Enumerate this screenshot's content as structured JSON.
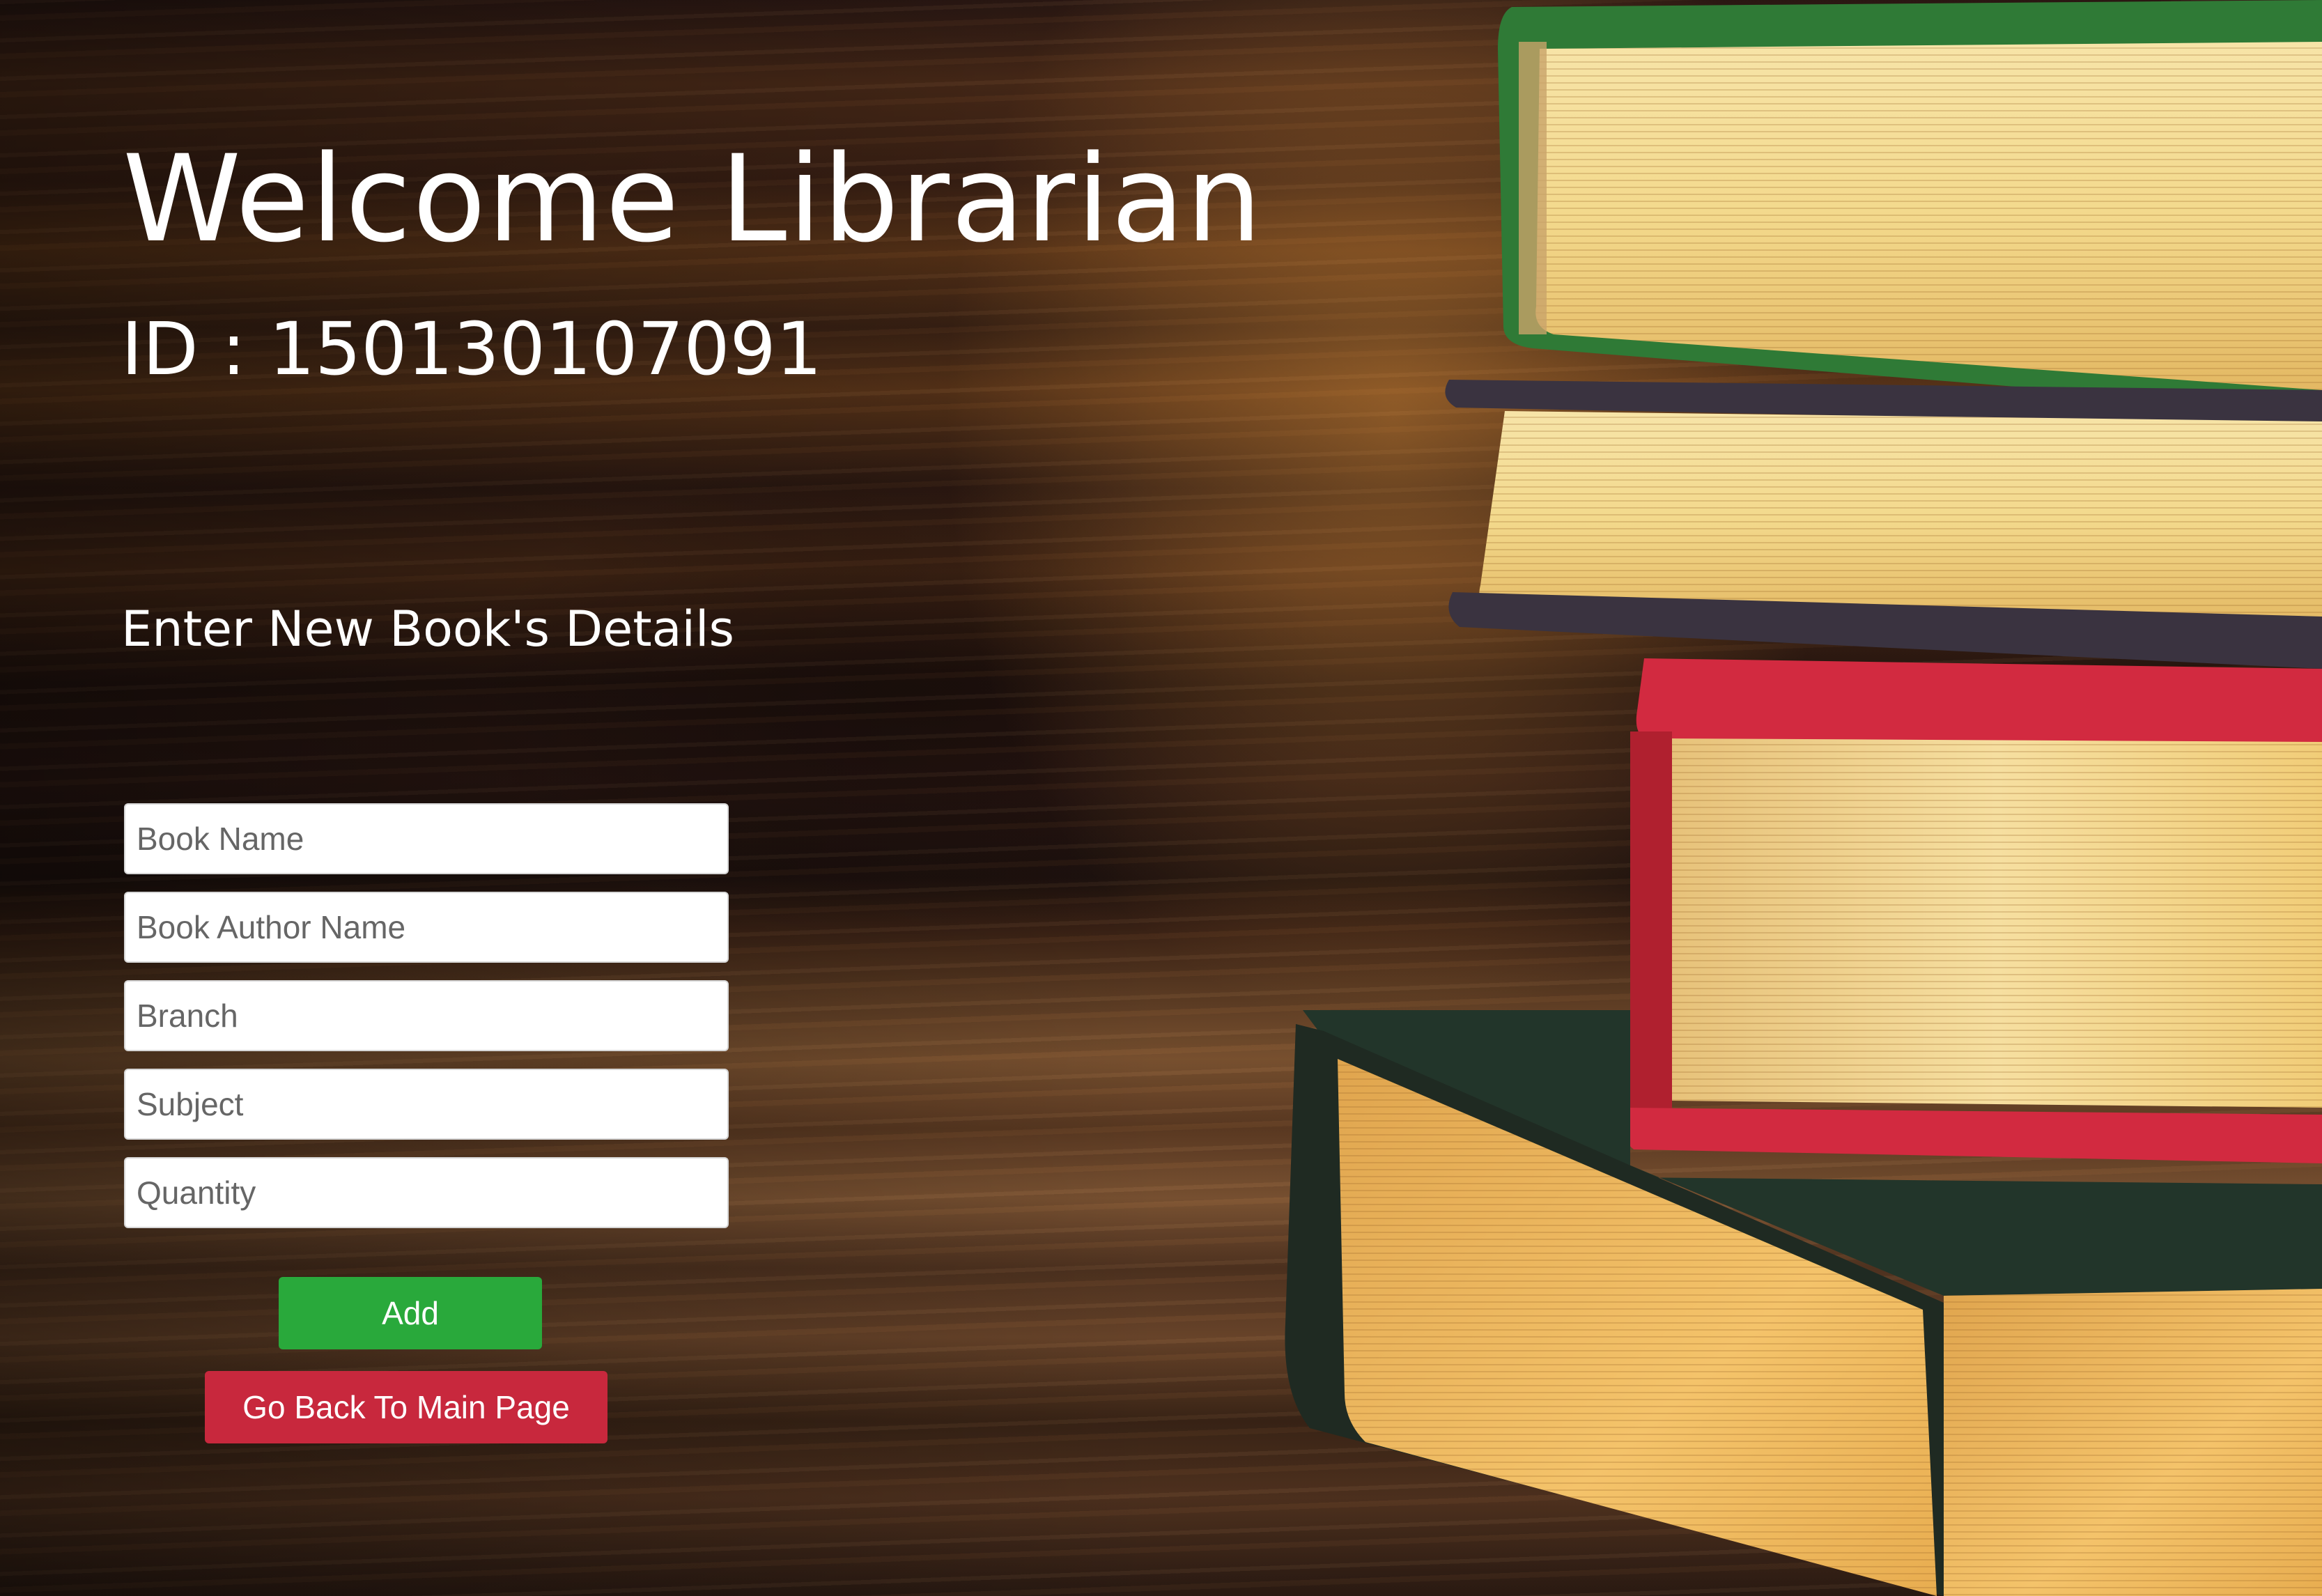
{
  "header": {
    "title": "Welcome Librarian",
    "id_line": "ID : 150130107091"
  },
  "form": {
    "section_title": "Enter New Book's Details",
    "fields": [
      {
        "placeholder": "Book Name",
        "value": ""
      },
      {
        "placeholder": "Book Author Name",
        "value": ""
      },
      {
        "placeholder": "Branch",
        "value": ""
      },
      {
        "placeholder": "Subject",
        "value": ""
      },
      {
        "placeholder": "Quantity",
        "value": ""
      }
    ],
    "add_label": "Add",
    "back_label": "Go Back To Main Page"
  },
  "colors": {
    "add_button": "#29a93b",
    "back_button": "#c8283d",
    "text": "#ffffff"
  }
}
